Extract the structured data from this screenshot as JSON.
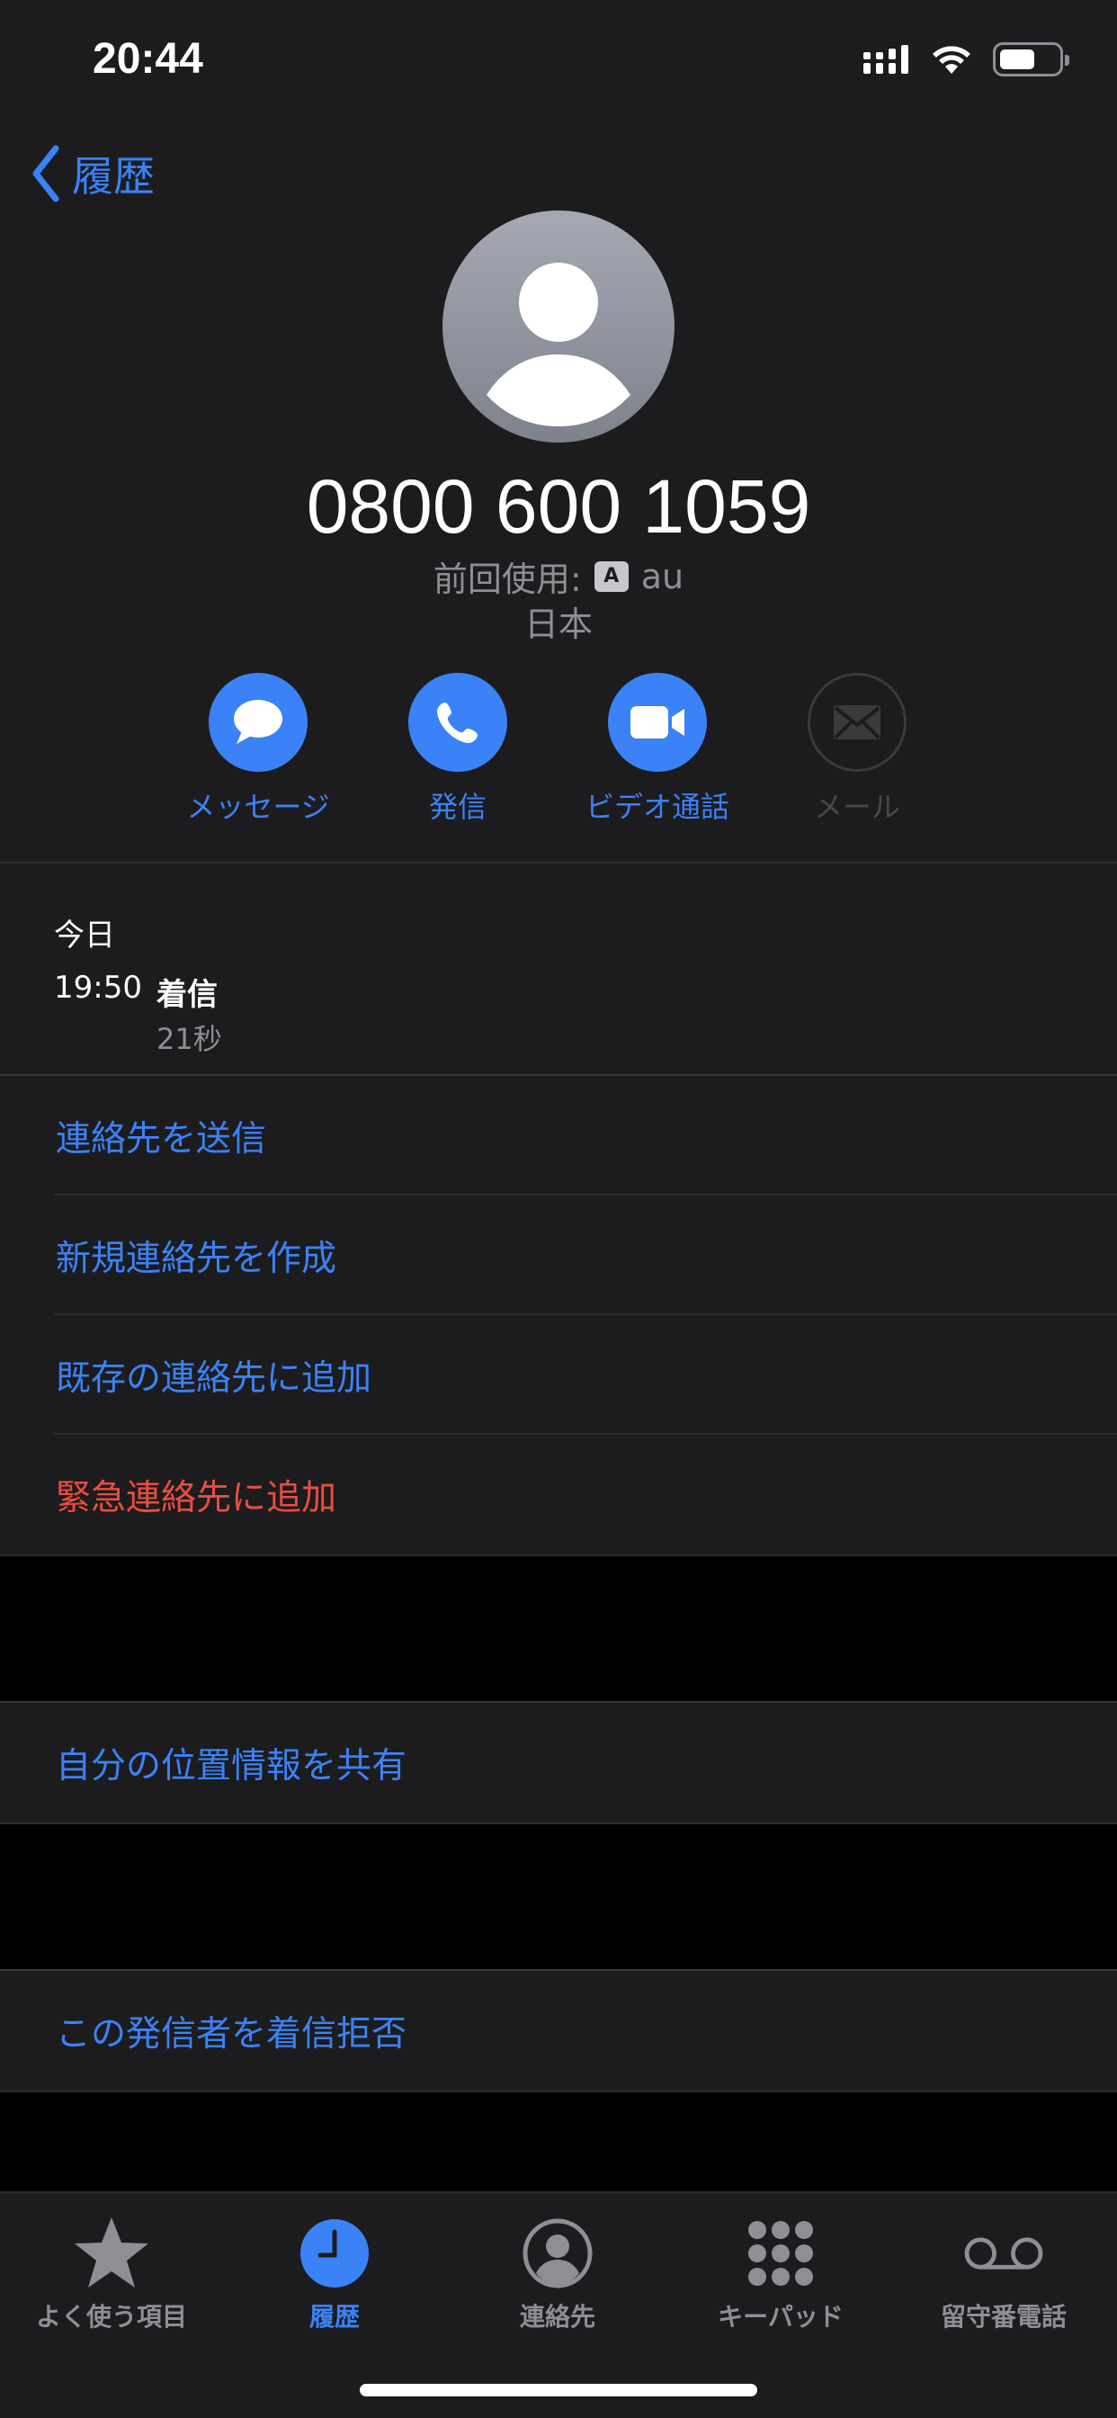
{
  "status_bar": {
    "time": "20:44"
  },
  "nav": {
    "back_label": "履歴"
  },
  "contact": {
    "phone_number": "0800 600 1059",
    "last_used_label": "前回使用:",
    "sim_badge": "A",
    "carrier": "au",
    "country": "日本"
  },
  "actions": [
    {
      "label": "メッセージ",
      "icon": "message-icon",
      "enabled": true
    },
    {
      "label": "発信",
      "icon": "phone-icon",
      "enabled": true
    },
    {
      "label": "ビデオ通話",
      "icon": "video-icon",
      "enabled": true
    },
    {
      "label": "メール",
      "icon": "mail-icon",
      "enabled": false
    }
  ],
  "history": {
    "day": "今日",
    "time": "19:50",
    "type": "着信",
    "duration": "21秒"
  },
  "options": [
    {
      "label": "連絡先を送信"
    },
    {
      "label": "新規連絡先を作成"
    },
    {
      "label": "既存の連絡先に追加"
    },
    {
      "label": "緊急連絡先に追加"
    }
  ],
  "location": {
    "label": "自分の位置情報を共有"
  },
  "block": {
    "label": "この発信者を着信拒否"
  },
  "tabs": [
    {
      "label": "よく使う項目",
      "icon": "star-icon"
    },
    {
      "label": "履歴",
      "icon": "clock-icon",
      "active": true
    },
    {
      "label": "連絡先",
      "icon": "contact-icon"
    },
    {
      "label": "キーパッド",
      "icon": "keypad-icon"
    },
    {
      "label": "留守番電話",
      "icon": "voicemail-icon"
    }
  ],
  "colors": {
    "accent": "#3b82f6",
    "danger": "#ea4d3f",
    "background": "#000000",
    "surface": "#1c1c1e",
    "secondary_text": "#8e8e93"
  }
}
